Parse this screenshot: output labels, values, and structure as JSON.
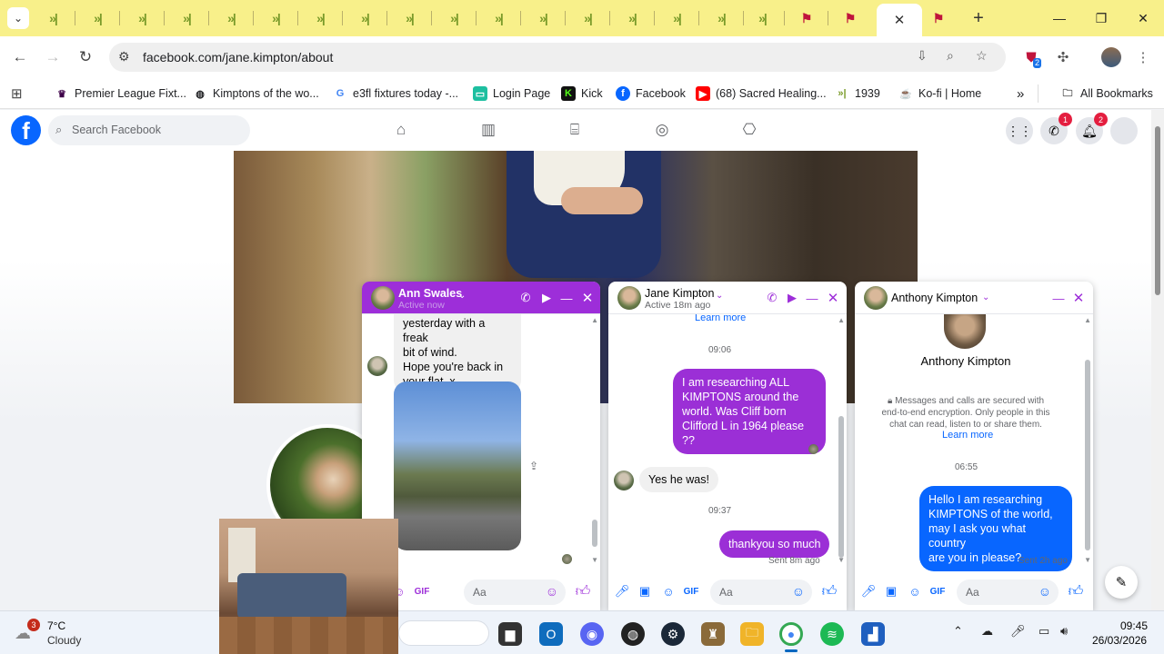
{
  "browser": {
    "url": "facebook.com/jane.kimpton/about",
    "tab_close": "✕",
    "new_tab": "+"
  },
  "bookmarks": [
    {
      "label": "Premier League Fixt...",
      "icon": "premier-league-icon",
      "color": "#3d0048"
    },
    {
      "label": "Kimptons of the wo...",
      "icon": "globe-icon",
      "color": "#202124"
    },
    {
      "label": "e3fl fixtures today -...",
      "icon": "google-icon",
      "color": "#4285f4"
    },
    {
      "label": "Login Page",
      "icon": "login-icon",
      "color": "#1dbfa0"
    },
    {
      "label": "Kick",
      "icon": "kick-icon",
      "color": "#53fc18"
    },
    {
      "label": "Facebook",
      "icon": "facebook-icon",
      "color": "#0866ff"
    },
    {
      "label": "(68) Sacred Healing...",
      "icon": "youtube-icon",
      "color": "#ff0000"
    },
    {
      "label": "1939",
      "icon": "1939-icon",
      "color": "#7a9b2a"
    },
    {
      "label": "Ko-fi | Home",
      "icon": "kofi-icon",
      "color": "#ff5e5b"
    }
  ],
  "all_bookmarks": "All Bookmarks",
  "extension_badge": "2",
  "facebook": {
    "search_placeholder": "Search Facebook",
    "messenger_badge": "1",
    "notifications_badge": "2"
  },
  "chats": {
    "ann": {
      "name": "Ann Swales",
      "status": "Active now",
      "messages_in_1": "yesterday with a freak",
      "messages_in_2": "bit of wind.",
      "messages_in_3": "Hope you're back in",
      "messages_in_4": "your flat. x",
      "input_placeholder": "Aa"
    },
    "jane": {
      "name": "Jane Kimpton",
      "status": "Active 18m ago",
      "learn_more": "Learn more",
      "time1": "09:06",
      "out1_l1": "I am researching ALL",
      "out1_l2": "KIMPTONS around the",
      "out1_l3": "world.  Was Cliff born",
      "out1_l4": "Clifford L in 1964 please ??",
      "in1": "Yes he was!",
      "time2": "09:37",
      "out2": "thankyou so much",
      "sent": "Sent 8m ago",
      "input_placeholder": "Aa"
    },
    "anthony": {
      "name": "Anthony Kimpton",
      "profile_name": "Anthony Kimpton",
      "enc_l1": "Messages and calls are secured with",
      "enc_l2": "end-to-end encryption. Only people in this",
      "enc_l3": "chat can read, listen to or share them.",
      "learn_more": "Learn more",
      "time1": "06:55",
      "out1_l1": "Hello I am researching",
      "out1_l2": "KIMPTONS of the world,",
      "out1_l3": "may I ask you what country",
      "out1_l4": "are you in please?",
      "sent": "Sent 2h ago",
      "input_placeholder": "Aa"
    }
  },
  "taskbar": {
    "weather_badge": "3",
    "temp": "7°C",
    "condition": "Cloudy",
    "time": "09:45",
    "date": "26/03/2026"
  }
}
